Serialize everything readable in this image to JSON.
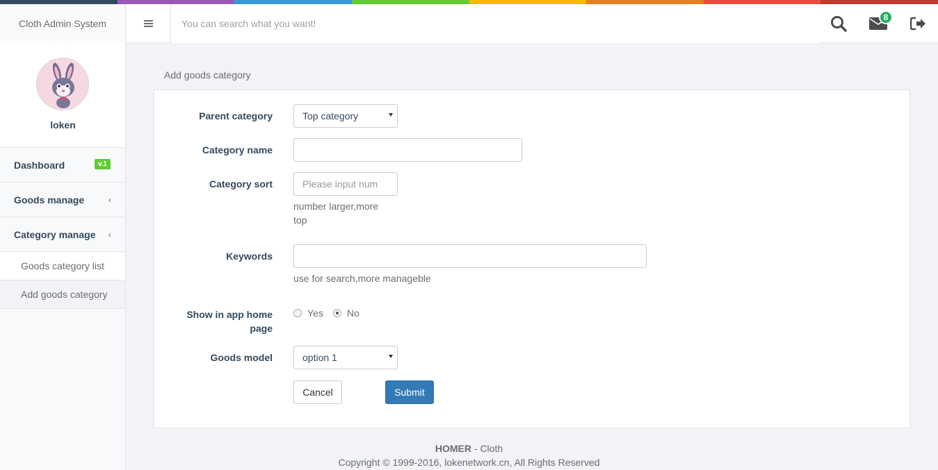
{
  "colors": {
    "stripe": [
      "#34495e",
      "#9b59b6",
      "#3498db",
      "#62cb31",
      "#ffb606",
      "#e67e22",
      "#e74c3c",
      "#c0392b"
    ],
    "submit": "#337ab7",
    "badge_green": "#27ae60",
    "version_badge": "#62cb31"
  },
  "header": {
    "brand": "Cloth Admin System",
    "search_placeholder": "You can search what you want!",
    "mail_count": "8",
    "icons": [
      "menu-icon",
      "search-icon",
      "envelope-icon",
      "sign-out-icon"
    ]
  },
  "sidebar": {
    "username": "loken",
    "items": [
      {
        "label": "Dashboard",
        "badge": "v.1"
      },
      {
        "label": "Goods manage",
        "chevron": "‹"
      },
      {
        "label": "Category manage",
        "chevron": "‹"
      }
    ],
    "subitems": [
      {
        "label": "Goods category list"
      },
      {
        "label": "Add goods category"
      }
    ]
  },
  "main": {
    "title": "Add goods category",
    "form": {
      "parent_label": "Parent category",
      "parent_value": "Top category",
      "name_label": "Category name",
      "name_value": "",
      "sort_label": "Category sort",
      "sort_placeholder": "Please input num",
      "sort_help_1": "number larger,more",
      "sort_help_2": "top",
      "keywords_label": "Keywords",
      "keywords_value": "",
      "keywords_help": "use for search,more manageble",
      "show_label_1": "Show in app home",
      "show_label_2": "page",
      "show_yes": "Yes",
      "show_no": "No",
      "show_selected": "No",
      "model_label": "Goods model",
      "model_value": "option 1",
      "cancel": "Cancel",
      "submit": "Submit"
    }
  },
  "footer": {
    "brand": "HOMER",
    "brand_suffix": " - Cloth",
    "copyright": "Copyright © 1999-2016, lokenetwork.cn, All Rights Reserved"
  }
}
